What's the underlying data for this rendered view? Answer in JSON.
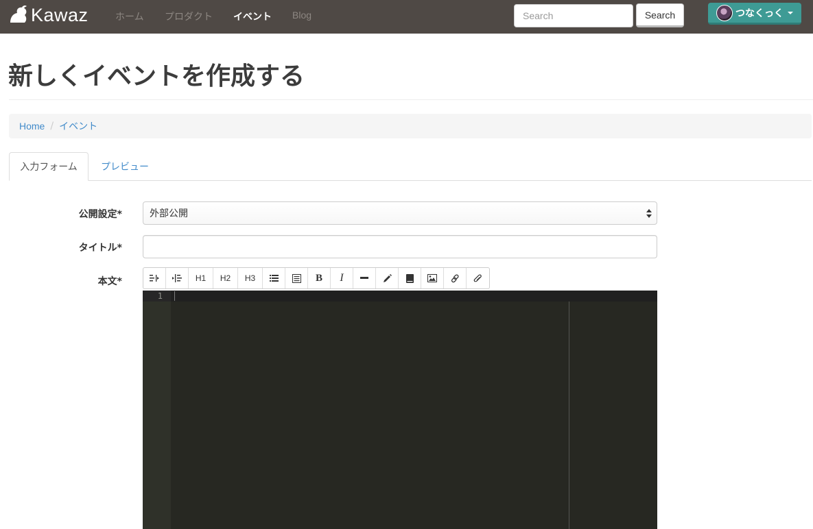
{
  "navbar": {
    "brand": "Kawaz",
    "links": [
      "ホーム",
      "プロダクト",
      "イベント",
      "Blog"
    ],
    "active_link": "イベント",
    "search_placeholder": "Search",
    "search_button": "Search",
    "user_name": "つなくっく"
  },
  "page": {
    "title": "新しくイベントを作成する"
  },
  "breadcrumb": {
    "items": [
      "Home",
      "イベント"
    ],
    "separator": "/"
  },
  "tabs": {
    "items": [
      "入力フォーム",
      "プレビュー"
    ],
    "active": "入力フォーム"
  },
  "form": {
    "visibility_label": "公開設定*",
    "visibility_value": "外部公開",
    "title_label": "タイトル*",
    "title_value": "",
    "body_label": "本文*"
  },
  "toolbar": {
    "buttons": [
      "outdent-icon",
      "indent-icon",
      "H1",
      "H2",
      "H3",
      "bullet-list-icon",
      "numbered-list-icon",
      "B",
      "I",
      "horizontal-rule-icon",
      "pencil-icon",
      "book-icon",
      "image-icon",
      "link-icon",
      "attachment-icon"
    ]
  },
  "editor": {
    "line_number": "1",
    "colors": {
      "background": "#272822",
      "gutter": "#2f3129"
    }
  },
  "colors": {
    "navbar": "#4f4945",
    "user_button": "#3e9b95",
    "link": "#428bca"
  }
}
